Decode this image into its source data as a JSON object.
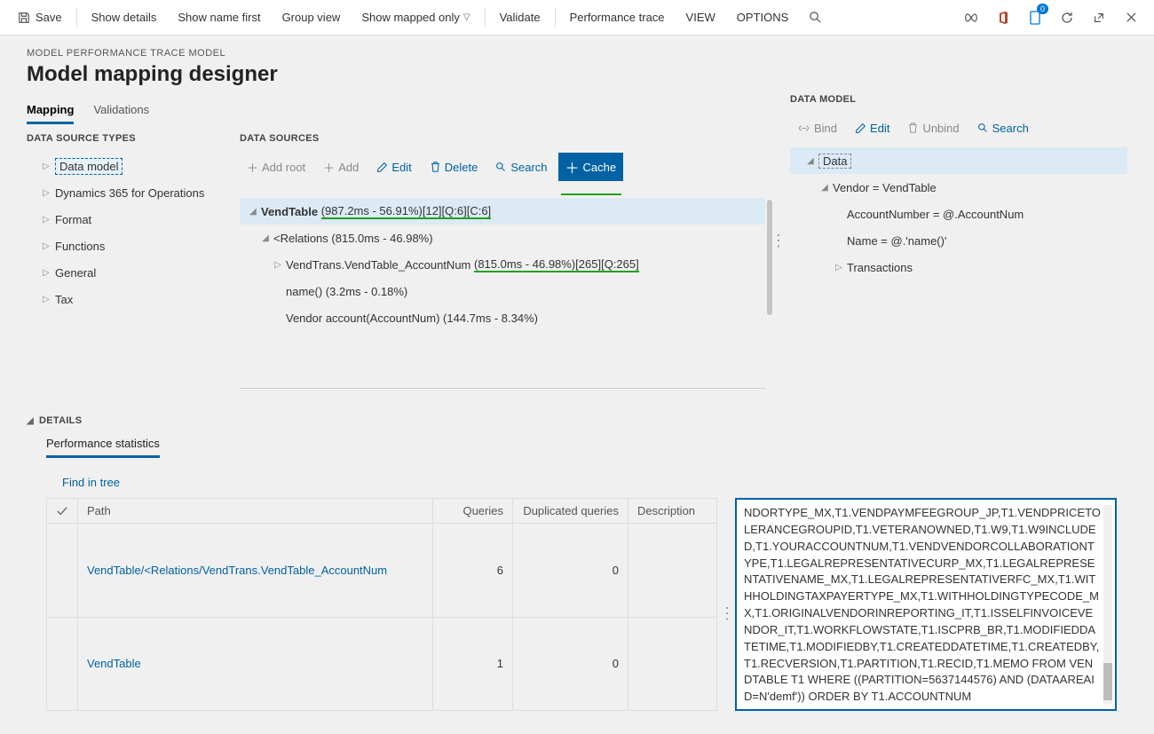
{
  "toolbar": {
    "save": "Save",
    "show_details": "Show details",
    "show_name_first": "Show name first",
    "group_view": "Group view",
    "show_mapped_only": "Show mapped only",
    "validate": "Validate",
    "performance_trace": "Performance trace",
    "view": "VIEW",
    "options": "OPTIONS",
    "badge_count": "0"
  },
  "crumb": "MODEL PERFORMANCE TRACE MODEL",
  "title": "Model mapping designer",
  "tabs": {
    "mapping": "Mapping",
    "validations": "Validations"
  },
  "dst": {
    "label": "DATA SOURCE TYPES",
    "items": [
      "Data model",
      "Dynamics 365 for Operations",
      "Format",
      "Functions",
      "General",
      "Tax"
    ]
  },
  "ds": {
    "label": "DATA SOURCES",
    "buttons": {
      "add_root": "Add root",
      "add": "Add",
      "edit": "Edit",
      "delete": "Delete",
      "search": "Search",
      "cache": "Cache"
    },
    "row0_a": "VendTable",
    "row0_b": "(987.2ms - 56.91%)[12][Q:6][C:6]",
    "row1": "<Relations (815.0ms - 46.98%)",
    "row2_a": "VendTrans.VendTable_AccountNum",
    "row2_b": "(815.0ms - 46.98%)[265][Q:265]",
    "row3": "name() (3.2ms - 0.18%)",
    "row4": "Vendor account(AccountNum) (144.7ms - 8.34%)"
  },
  "dm": {
    "label": "DATA MODEL",
    "buttons": {
      "bind": "Bind",
      "edit": "Edit",
      "unbind": "Unbind",
      "search": "Search"
    },
    "row0": "Data",
    "row1": "Vendor = VendTable",
    "row2": "AccountNumber = @.AccountNum",
    "row3": "Name = @.'name()'",
    "row4": "Transactions"
  },
  "details": {
    "label": "DETAILS",
    "tab": "Performance statistics",
    "find": "Find in tree",
    "cols": {
      "path": "Path",
      "queries": "Queries",
      "dup": "Duplicated queries",
      "desc": "Description"
    },
    "rows": [
      {
        "path": "VendTable/<Relations/VendTrans.VendTable_AccountNum",
        "queries": "6",
        "dup": "0"
      },
      {
        "path": "VendTable",
        "queries": "1",
        "dup": "0"
      }
    ],
    "sql": "NDORTYPE_MX,T1.VENDPAYMFEEGROUP_JP,T1.VENDPRICETOLERANCEGROUPID,T1.VETERANOWNED,T1.W9,T1.W9INCLUDED,T1.YOURACCOUNTNUM,T1.VENDVENDORCOLLABORATIONTYPE,T1.LEGALREPRESENTATIVECURP_MX,T1.LEGALREPRESENTATIVENAME_MX,T1.LEGALREPRESENTATIVERFC_MX,T1.WITHHOLDINGTAXPAYERTYPE_MX,T1.WITHHOLDINGTYPECODE_MX,T1.ORIGINALVENDORINREPORTING_IT,T1.ISSELFINVOICEVENDOR_IT,T1.WORKFLOWSTATE,T1.ISCPRB_BR,T1.MODIFIEDDATETIME,T1.MODIFIEDBY,T1.CREATEDDATETIME,T1.CREATEDBY,T1.RECVERSION,T1.PARTITION,T1.RECID,T1.MEMO FROM VENDTABLE T1 WHERE ((PARTITION=5637144576) AND (DATAAREAID=N'demf')) ORDER BY T1.ACCOUNTNUM"
  }
}
